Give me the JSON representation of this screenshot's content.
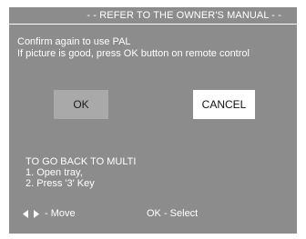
{
  "header": {
    "title": "- - REFER TO THE OWNER'S MANUAL - -"
  },
  "message": {
    "line1": "Confirm again to use PAL",
    "line2": "If picture is good, press OK button on remote control"
  },
  "buttons": {
    "ok_label": "OK",
    "cancel_label": "CANCEL"
  },
  "instructions": {
    "title": "TO GO BACK TO MULTI",
    "step1": "1. Open tray,",
    "step2": "2.  Press '3' Key"
  },
  "footer": {
    "move_icon": "left-right-arrows-icon",
    "move_label": "- Move",
    "select_label": "OK - Select"
  },
  "colors": {
    "background": "#8c8c8c",
    "text": "#ffffff",
    "ok_button": "#a9a9a9",
    "cancel_button": "#ffffff"
  }
}
